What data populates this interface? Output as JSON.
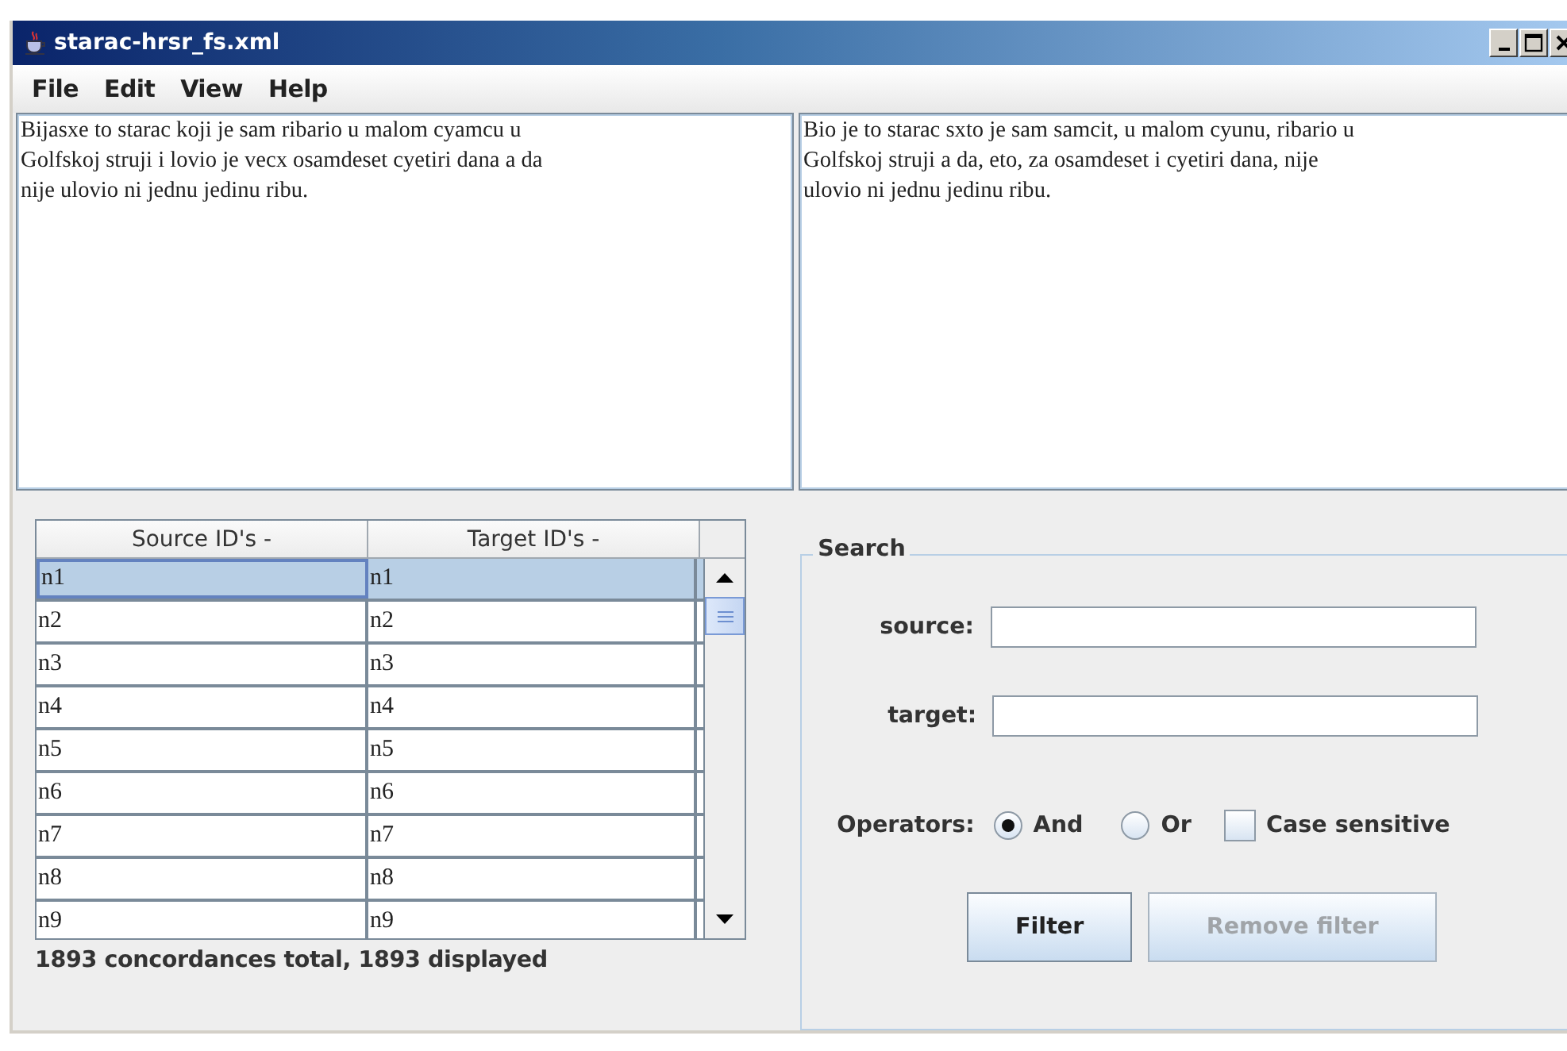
{
  "window": {
    "title": "starac-hrsr_fs.xml"
  },
  "menu": [
    {
      "label": "File"
    },
    {
      "label": "Edit"
    },
    {
      "label": "View"
    },
    {
      "label": "Help"
    }
  ],
  "source_text": [
    "Bijasxe to starac koji je sam ribario u malom cyamcu u",
    "Golfskoj struji i lovio je vecx osamdeset cyetiri dana a da",
    "nije ulovio ni jednu jedinu ribu."
  ],
  "target_text": [
    "Bio je to starac sxto je sam samcit, u malom cyunu, ribario u",
    "Golfskoj struji a da, eto, za osamdeset i cyetiri dana, nije",
    "ulovio ni jednu jedinu ribu."
  ],
  "table": {
    "columns": [
      "Source ID's -",
      "Target ID's -"
    ],
    "rows": [
      {
        "cells": [
          "n1",
          "n1"
        ],
        "selected": true
      },
      {
        "cells": [
          "n2",
          "n2"
        ],
        "selected": false
      },
      {
        "cells": [
          "n3",
          "n3"
        ],
        "selected": false
      },
      {
        "cells": [
          "n4",
          "n4"
        ],
        "selected": false
      },
      {
        "cells": [
          "n5",
          "n5"
        ],
        "selected": false
      },
      {
        "cells": [
          "n6",
          "n6"
        ],
        "selected": false
      },
      {
        "cells": [
          "n7",
          "n7"
        ],
        "selected": false
      },
      {
        "cells": [
          "n8",
          "n8"
        ],
        "selected": false
      },
      {
        "cells": [
          "n9",
          "n9"
        ],
        "selected": false
      }
    ]
  },
  "status": "1893 concordances total, 1893 displayed",
  "search": {
    "title": "Search",
    "fields": [
      {
        "label": "source:"
      },
      {
        "label": "target:"
      }
    ],
    "operators_label": "Operators:",
    "operators": [
      {
        "label": "And",
        "selected": true
      },
      {
        "label": "Or",
        "selected": false
      }
    ],
    "case_sensitive": {
      "label": "Case sensitive",
      "checked": false
    },
    "buttons": [
      {
        "label": "Filter",
        "disabled": false
      },
      {
        "label": "Remove filter",
        "disabled": true
      }
    ]
  }
}
